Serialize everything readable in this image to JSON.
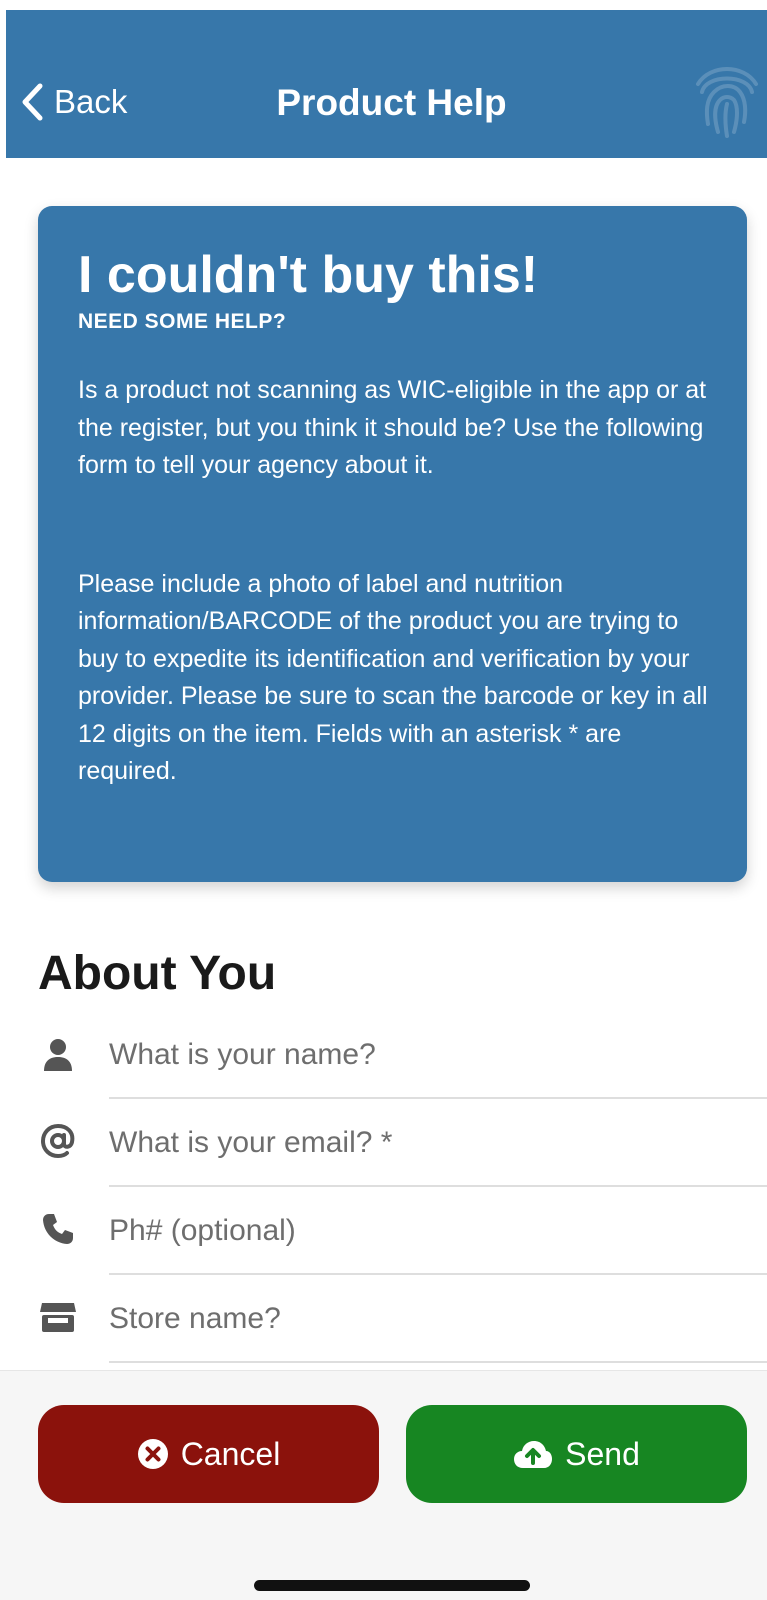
{
  "header": {
    "back_label": "Back",
    "title": "Product Help",
    "color": "#3777aa"
  },
  "info_card": {
    "title": "I couldn't buy this!",
    "subtitle": "NEED SOME HELP?",
    "paragraph1": "Is a product not scanning as WIC-eligible in the app or at the register, but you think it should be? Use the following form to tell your agency about it.",
    "paragraph2": "Please include a photo of label and nutrition information/BARCODE of the product you are trying to buy to expedite its identification and verification by your provider. Please be sure to scan the barcode or key in all 12 digits on the item. Fields with an asterisk * are required."
  },
  "about_you": {
    "title": "About You",
    "fields": [
      {
        "icon": "person-icon",
        "value": "",
        "placeholder": "What is your name?"
      },
      {
        "icon": "at-sign-icon",
        "value": "",
        "placeholder": "What is your email? *"
      },
      {
        "icon": "phone-icon",
        "value": "",
        "placeholder": "Ph# (optional)"
      },
      {
        "icon": "store-icon",
        "value": "",
        "placeholder": "Store name?"
      }
    ]
  },
  "footer": {
    "cancel_label": "Cancel",
    "cancel_icon": "close-circle-icon",
    "cancel_color": "#8b120c",
    "send_label": "Send",
    "send_icon": "cloud-upload-icon",
    "send_color": "#178622"
  }
}
